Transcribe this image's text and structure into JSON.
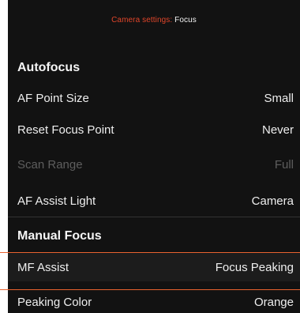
{
  "header": {
    "crumb": "Camera settings:",
    "current": "Focus"
  },
  "autofocus": {
    "title": "Autofocus",
    "items": [
      {
        "label": "AF Point Size",
        "value": "Small"
      },
      {
        "label": "Reset Focus Point",
        "value": "Never"
      },
      {
        "label": "Scan Range",
        "value": "Full"
      },
      {
        "label": "AF Assist Light",
        "value": "Camera"
      }
    ]
  },
  "manual": {
    "title": "Manual Focus",
    "items": [
      {
        "label": "MF Assist",
        "value": "Focus Peaking"
      },
      {
        "label": "Peaking Color",
        "value": "Orange"
      }
    ]
  },
  "colors": {
    "accent": "#e8622f",
    "background": "#121212",
    "disabled_text": "#5e5e5e"
  }
}
